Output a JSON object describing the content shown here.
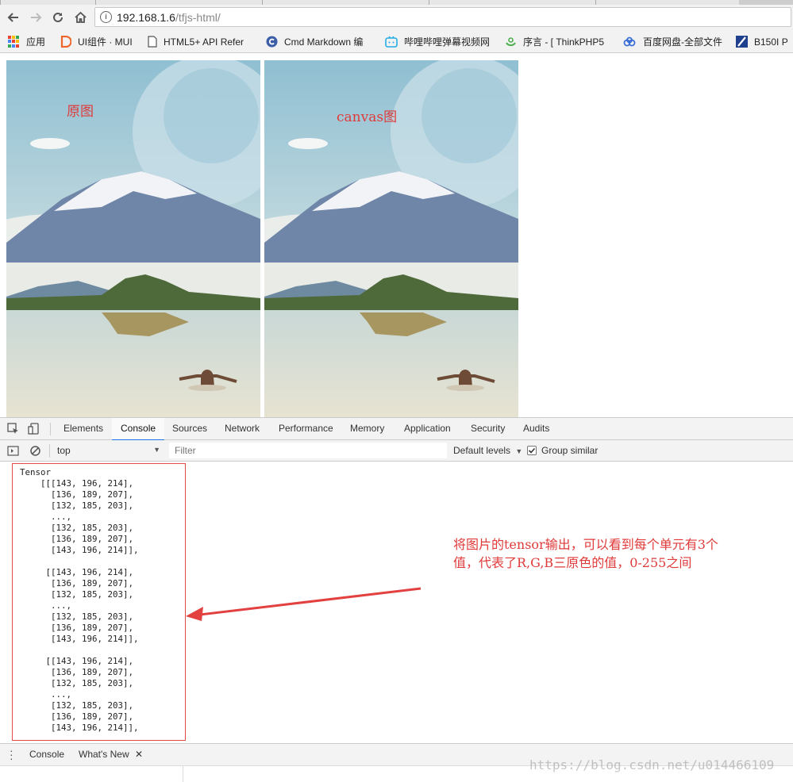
{
  "browser": {
    "url_host": "192.168.1.6",
    "url_path": "/tfjs-html/",
    "bookmarks": [
      "应用",
      "UI组件 · MUI",
      "HTML5+ API Refer",
      "Cmd Markdown 编",
      "哔哩哔哩弹幕视频网",
      "序言 - [ ThinkPHP5",
      "百度网盘-全部文件",
      "B150I P"
    ]
  },
  "page": {
    "left_label": "原图",
    "right_label": "canvas图"
  },
  "devtools": {
    "tabs": [
      "Elements",
      "Console",
      "Sources",
      "Network",
      "Performance",
      "Memory",
      "Application",
      "Security",
      "Audits"
    ],
    "active_tab": "Console",
    "context": "top",
    "filter_placeholder": "Filter",
    "levels": "Default levels",
    "group_similar": "Group similar",
    "console_output": "Tensor\n    [[[143, 196, 214],\n      [136, 189, 207],\n      [132, 185, 203],\n      ...,\n      [132, 185, 203],\n      [136, 189, 207],\n      [143, 196, 214]],\n\n     [[143, 196, 214],\n      [136, 189, 207],\n      [132, 185, 203],\n      ...,\n      [132, 185, 203],\n      [136, 189, 207],\n      [143, 196, 214]],\n\n     [[143, 196, 214],\n      [136, 189, 207],\n      [132, 185, 203],\n      ...,\n      [132, 185, 203],\n      [136, 189, 207],\n      [143, 196, 214]],",
    "annotation_line1": "将图片的tensor输出，可以看到每个单元有3个",
    "annotation_line2": "值，代表了R,G,B三原色的值，0-255之间",
    "drawer_tabs": [
      "Console",
      "What's New"
    ]
  },
  "watermark": "https://blog.csdn.net/u014466109",
  "colors": {
    "annotation": "#e03a3a",
    "active_tab": "#1a73e8"
  }
}
